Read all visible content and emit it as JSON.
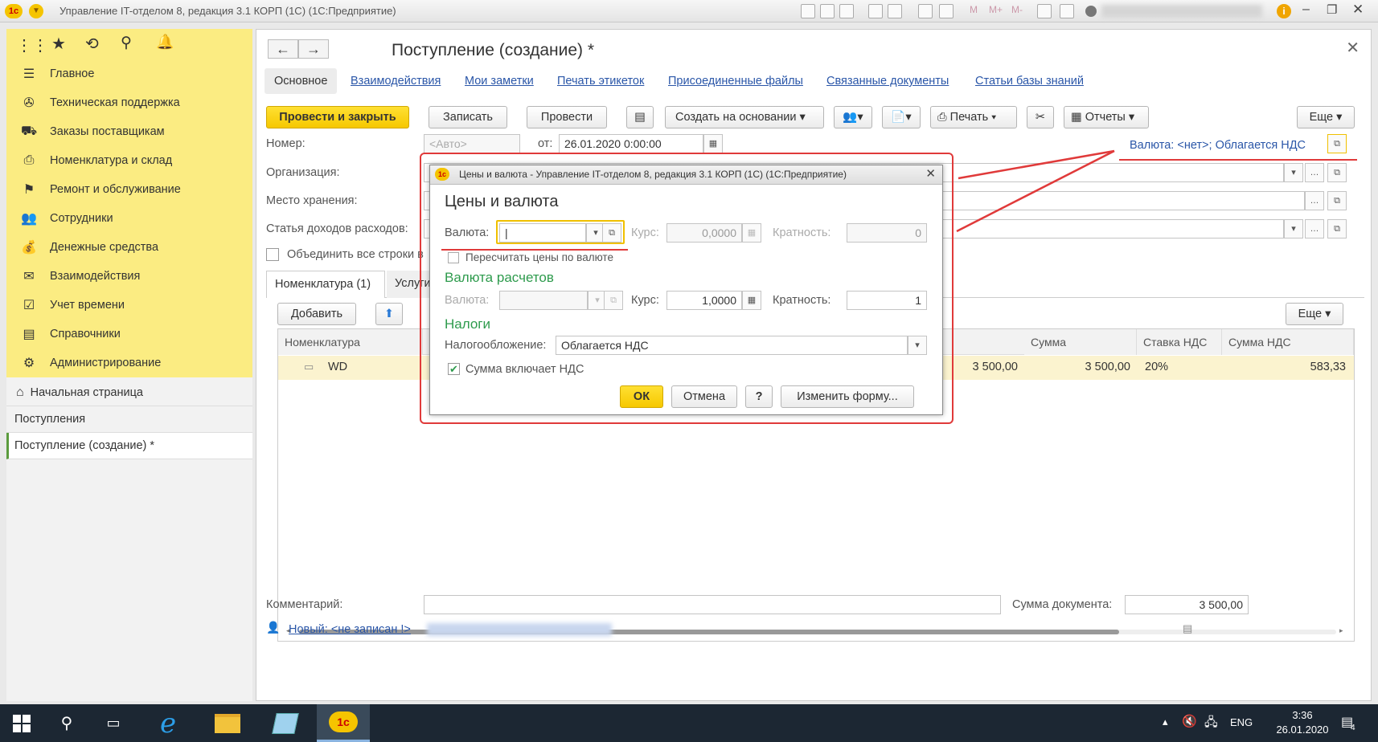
{
  "window": {
    "title": "Управление IT-отделом 8, редакция 3.1 КОРП (1С)  (1С:Предприятие)",
    "logo": "1с",
    "m_labels": [
      "M",
      "M+",
      "M-"
    ]
  },
  "sidebar": {
    "items": [
      {
        "icon": "menu-icon",
        "glyph": "☰",
        "label": "Главное"
      },
      {
        "icon": "support-icon",
        "glyph": "✇",
        "label": "Техническая поддержка"
      },
      {
        "icon": "truck-icon",
        "glyph": "⛟",
        "label": "Заказы поставщикам"
      },
      {
        "icon": "printer-icon",
        "glyph": "⎙",
        "label": "Номенклатура и склад"
      },
      {
        "icon": "flag-icon",
        "glyph": "⚑",
        "label": "Ремонт и обслуживание"
      },
      {
        "icon": "people-icon",
        "glyph": "👥",
        "label": "Сотрудники"
      },
      {
        "icon": "money-icon",
        "glyph": "💰",
        "label": "Денежные средства"
      },
      {
        "icon": "envelope-icon",
        "glyph": "✉",
        "label": "Взаимодействия"
      },
      {
        "icon": "calendar-check-icon",
        "glyph": "☑",
        "label": "Учет времени"
      },
      {
        "icon": "book-icon",
        "glyph": "▤",
        "label": "Справочники"
      },
      {
        "icon": "gear-icon",
        "glyph": "⚙",
        "label": "Администрирование"
      }
    ]
  },
  "open_windows": [
    {
      "icon": "home-icon",
      "glyph": "⌂",
      "label": "Начальная страница"
    },
    {
      "label": "Поступления"
    },
    {
      "label": "Поступление (создание) *",
      "active": true
    }
  ],
  "form": {
    "title": "Поступление (создание) *",
    "tabs": [
      "Основное",
      "Взаимодействия",
      "Мои заметки",
      "Печать этикеток",
      "Присоединенные файлы",
      "Связанные документы",
      "Статьи базы знаний"
    ],
    "toolbar": {
      "post_close": "Провести и закрыть",
      "save": "Записать",
      "post": "Провести",
      "create_based": "Создать на основании",
      "print": "Печать",
      "reports": "Отчеты",
      "more": "Еще"
    },
    "fields": {
      "number_label": "Номер:",
      "number_placeholder": "<Авто>",
      "date_label": "от:",
      "date_value": "26.01.2020  0:00:00",
      "currency_link": "Валюта: <нет>; Облагается НДС",
      "org_label": "Организация:",
      "storage_label": "Место хранения:",
      "income_label": "Статья доходов расходов:",
      "merge_label": "Объединить все строки в",
      "comment_label": "Комментарий:",
      "doc_sum_label": "Сумма документа:",
      "doc_sum_value": "3 500,00",
      "author_link": "Новый: <не записан !>"
    },
    "table_tabs": [
      "Номенклатура (1)",
      "Услуги"
    ],
    "table_add": "Добавить",
    "table_more": "Еще",
    "columns": {
      "nomenclature": "Номенклатура",
      "sum": "Сумма",
      "vat_rate": "Ставка НДС",
      "vat_sum": "Сумма НДС"
    },
    "rows": [
      {
        "name": "WD",
        "price": "3 500,00",
        "sum": "3 500,00",
        "vat_rate": "20%",
        "vat_sum": "583,33"
      }
    ]
  },
  "dialog": {
    "title": "Цены и валюта - Управление IT-отделом 8, редакция 3.1 КОРП (1С)  (1С:Предприятие)",
    "heading": "Цены и валюта",
    "currency_label": "Валюта:",
    "currency_value": "|",
    "rate_label": "Курс:",
    "rate_value": "0,0000",
    "mult_label": "Кратность:",
    "mult_value": "0",
    "recalc_label": "Пересчитать цены по валюте",
    "settle_section": "Валюта расчетов",
    "settle_currency_label": "Валюта:",
    "settle_rate_label": "Курс:",
    "settle_rate_value": "1,0000",
    "settle_mult_label": "Кратность:",
    "settle_mult_value": "1",
    "tax_section": "Налоги",
    "tax_label": "Налогообложение:",
    "tax_value": "Облагается НДС",
    "vat_incl_label": "Сумма включает НДС",
    "vat_incl_checked": true,
    "ok": "ОК",
    "cancel": "Отмена",
    "help": "?",
    "change_form": "Изменить форму..."
  },
  "taskbar": {
    "lang": "ENG",
    "time": "3:36",
    "date": "26.01.2020",
    "notifications": "4"
  },
  "colors": {
    "accent_yellow": "#fbec82",
    "annotation_red": "#e03a3a",
    "section_green": "#2e9b4d",
    "link_blue": "#2a56a8"
  }
}
